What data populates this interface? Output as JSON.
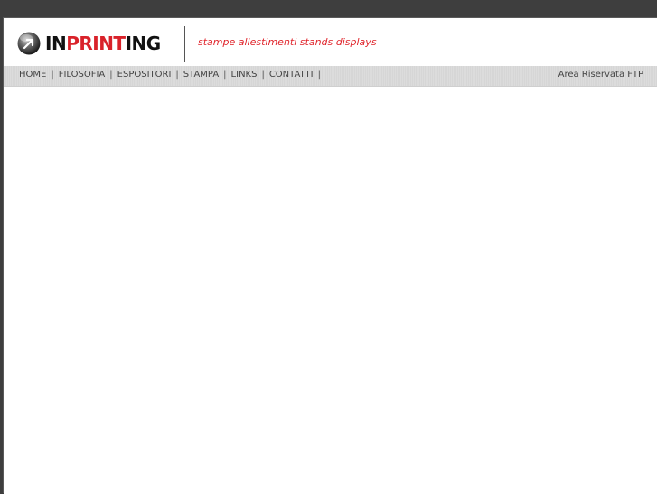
{
  "logo": {
    "part1": "IN",
    "part2": "PRINT",
    "part3": "ING",
    "icon": "ball-arrow-icon"
  },
  "tagline": "stampe allestimenti stands displays",
  "nav": {
    "items": [
      {
        "label": "HOME",
        "sep": "|"
      },
      {
        "label": "FILOSOFIA",
        "sep": "|"
      },
      {
        "label": "ESPOSITORI",
        "sep": "|"
      },
      {
        "label": "STAMPA",
        "sep": "|"
      },
      {
        "label": "LINKS",
        "sep": "|"
      },
      {
        "label": "CONTATTI",
        "sep": "|"
      }
    ],
    "ftp_label": "Area Riservata FTP"
  },
  "colors": {
    "outer_background": "#3e3e3e",
    "brand_red": "#d9222a",
    "tagline_red": "#e0262d",
    "nav_bar": "#d9d9d9"
  }
}
